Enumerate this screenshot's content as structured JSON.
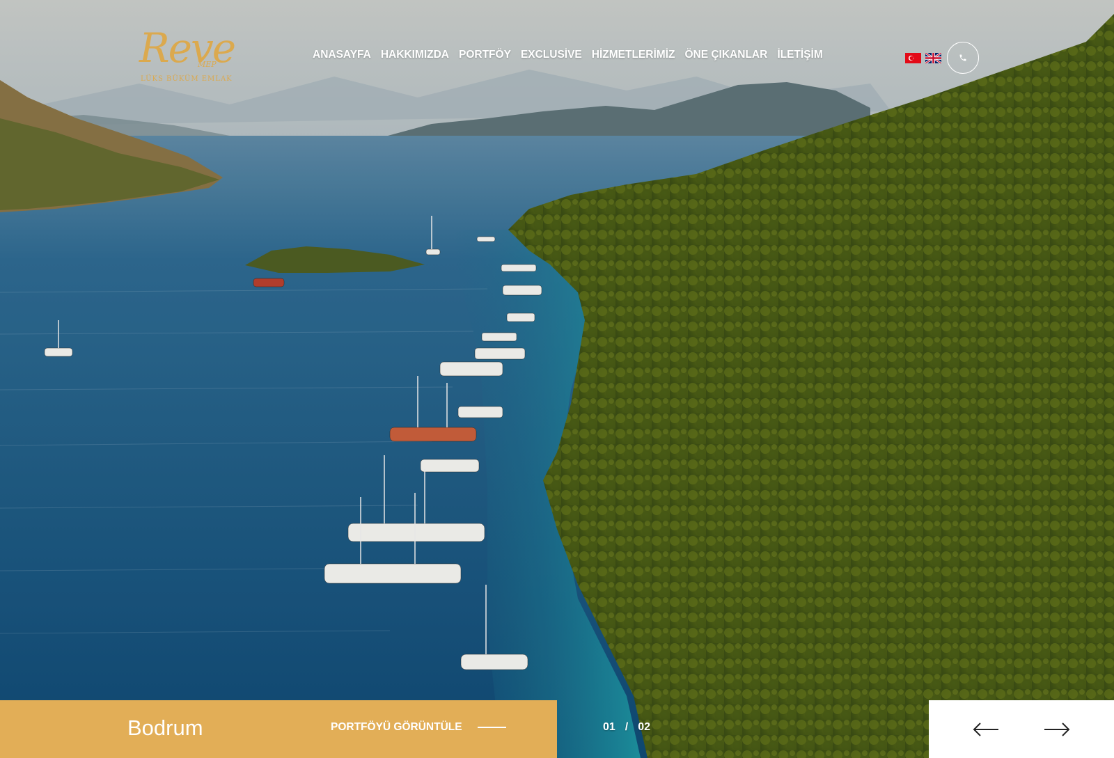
{
  "logo": {
    "script": "Reve",
    "sub": "MEP",
    "tagline": "LÜKS BÜKÜM EMLAK"
  },
  "nav": {
    "items": [
      {
        "label": "ANASAYFA"
      },
      {
        "label": "HAKKIMIZDA"
      },
      {
        "label": "PORTFÖY"
      },
      {
        "label": "EXCLUSİVE"
      },
      {
        "label": "HİZMETLERİMİZ"
      },
      {
        "label": "ÖNE ÇIKANLAR"
      },
      {
        "label": "İLETİŞİM"
      }
    ]
  },
  "header": {
    "flags": [
      "turkish-flag",
      "uk-flag"
    ],
    "phone_icon": "phone-icon"
  },
  "slide": {
    "title": "Bodrum",
    "link_label": "PORTFÖYÜ GÖRÜNTÜLE",
    "current": "01",
    "separator": "/",
    "total": "02"
  },
  "slider_nav": {
    "prev_icon": "arrow-left-icon",
    "next_icon": "arrow-right-icon"
  },
  "colors": {
    "accent": "#e2ae57",
    "logo": "#dba94e",
    "text": "#ffffff"
  }
}
